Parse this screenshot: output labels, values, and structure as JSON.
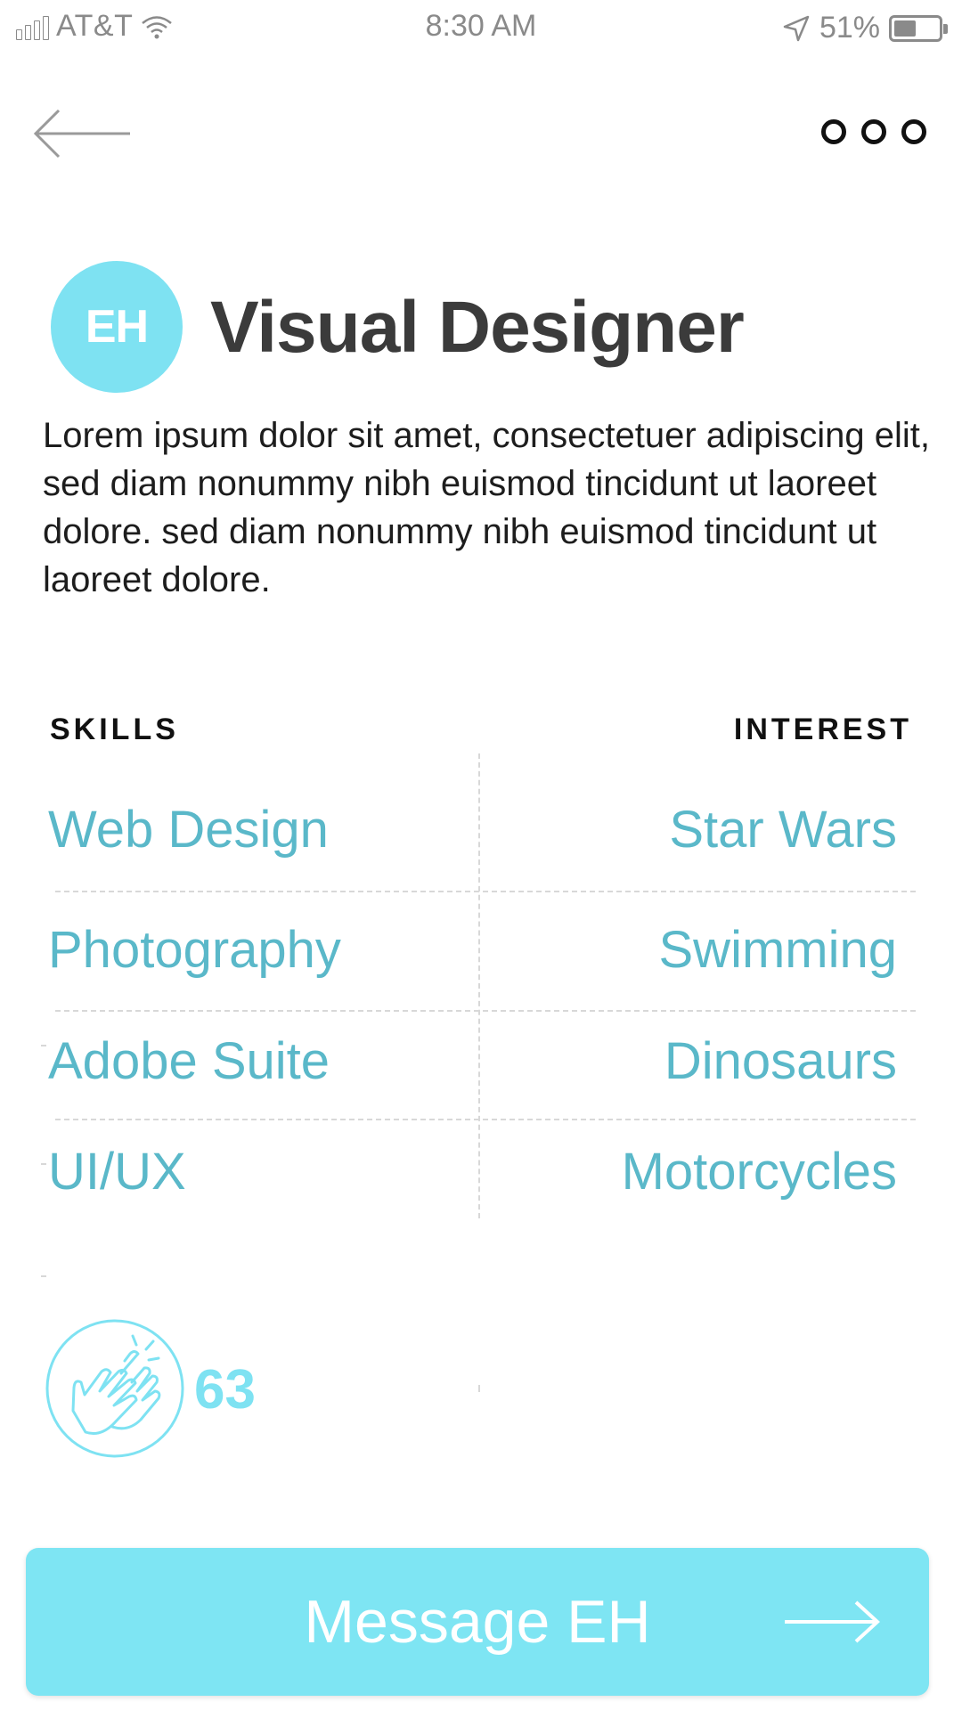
{
  "status_bar": {
    "carrier": "AT&T",
    "time": "8:30 AM",
    "battery_percent": "51%",
    "battery_level": 0.51
  },
  "nav": {
    "back_icon": "arrow-left-icon",
    "more_icon": "more-horizontal-icon"
  },
  "profile": {
    "initials": "EH",
    "title": "Visual Designer",
    "bio": "Lorem ipsum dolor sit amet, consectetuer adipiscing elit, sed diam nonummy nibh euismod tincidunt ut laoreet dolore. sed diam nonummy nibh euismod tincidunt ut laoreet dolore.",
    "avatar_color": "#7ee2f2"
  },
  "skills": {
    "heading": "SKILLS",
    "items": [
      "Web Design",
      "Photography",
      "Adobe Suite",
      "UI/UX"
    ]
  },
  "interests": {
    "heading": "INTEREST",
    "items": [
      "Star Wars",
      "Swimming",
      "Dinosaurs",
      "Motorcycles"
    ]
  },
  "claps": {
    "icon": "clapping-hands-icon",
    "count": "63"
  },
  "cta": {
    "label": "Message EH",
    "icon": "arrow-right-icon",
    "color": "#7ee5f3"
  },
  "colors": {
    "accent": "#7ee2f2",
    "list_text": "#5ab8c9",
    "title_text": "#3b3b3b"
  }
}
